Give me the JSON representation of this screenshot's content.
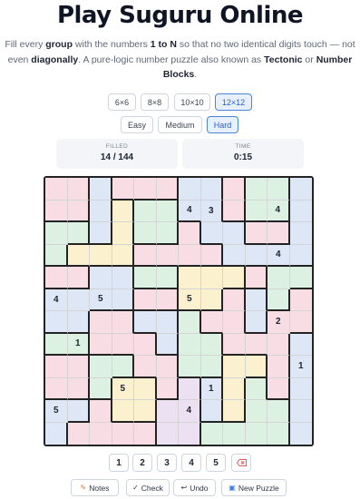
{
  "header": {
    "title": "Play Suguru Online",
    "desc": {
      "p1": "Fill every ",
      "b1": "group",
      "p2": " with the numbers ",
      "b2": "1 to N",
      "p3": " so that no two identical digits touch — not even ",
      "b3": "diagonally",
      "p4": ". A pure-logic number puzzle also known as ",
      "b4": "Tectonic",
      "p5": " or ",
      "b5": "Number Blocks",
      "p6": "."
    }
  },
  "sizes": [
    {
      "label": "6×6",
      "active": false
    },
    {
      "label": "8×8",
      "active": false
    },
    {
      "label": "10×10",
      "active": false
    },
    {
      "label": "12×12",
      "active": true
    }
  ],
  "difficulty": [
    {
      "label": "Easy",
      "active": false
    },
    {
      "label": "Medium",
      "active": false
    },
    {
      "label": "Hard",
      "active": true
    }
  ],
  "stats": {
    "filled_label": "FILLED",
    "filled_value": "14 / 144",
    "time_label": "TIME",
    "time_value": "0:15"
  },
  "board": {
    "size": 12,
    "palette": {
      "R": "#f9dde4",
      "B": "#dde7f6",
      "Y": "#fbf1cf",
      "G": "#dcf1e2",
      "P": "#ebe1f3"
    },
    "colors": [
      "RRBRRRBBRGGB",
      "RRBYGGBBRGGB",
      "GGBYGGRBBRRB",
      "GYYYRRRRBBBB",
      "RRBBGGYYYRGG",
      "BBBBRRYYRBGR",
      "BBRRBBGRRBRR",
      "GGRRRBGGRRRB",
      "RRGGRRGGYYRB",
      "RRGYYRPBYGRB",
      "BBRYYPPBYGGB",
      "BRRRRPPGGGGB"
    ],
    "givens": [
      {
        "r": 1,
        "c": 6,
        "v": "4"
      },
      {
        "r": 1,
        "c": 7,
        "v": "3"
      },
      {
        "r": 1,
        "c": 10,
        "v": "4"
      },
      {
        "r": 3,
        "c": 10,
        "v": "4"
      },
      {
        "r": 5,
        "c": 0,
        "v": "4"
      },
      {
        "r": 5,
        "c": 2,
        "v": "5"
      },
      {
        "r": 5,
        "c": 6,
        "v": "5"
      },
      {
        "r": 6,
        "c": 10,
        "v": "2"
      },
      {
        "r": 7,
        "c": 1,
        "v": "1"
      },
      {
        "r": 8,
        "c": 11,
        "v": "1"
      },
      {
        "r": 9,
        "c": 3,
        "v": "5"
      },
      {
        "r": 9,
        "c": 7,
        "v": "1"
      },
      {
        "r": 10,
        "c": 0,
        "v": "5"
      },
      {
        "r": 10,
        "c": 6,
        "v": "4"
      }
    ]
  },
  "keypad": {
    "digits": [
      "1",
      "2",
      "3",
      "4",
      "5"
    ],
    "erase_icon": "eraser-icon"
  },
  "actions": {
    "notes": "Notes",
    "check": "Check",
    "undo": "Undo",
    "new_puzzle": "New Puzzle"
  },
  "icons": {
    "notes": "pencil-icon",
    "check": "checkmark-icon",
    "undo": "undo-arrow-icon",
    "new_puzzle": "grid-icon"
  }
}
